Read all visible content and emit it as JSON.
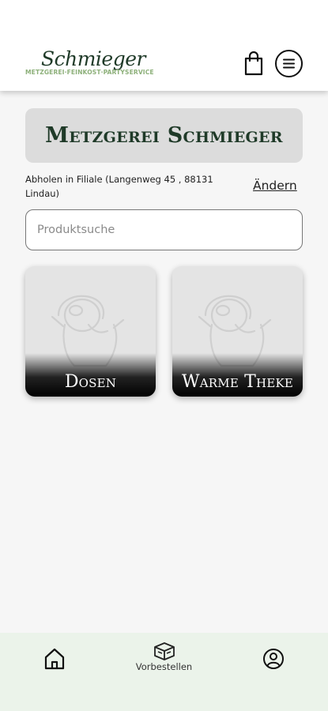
{
  "header": {
    "logo": {
      "script_text": "Schmieger",
      "tagline": "METZGEREI·FEINKOST·PARTYSERVICE"
    },
    "cart_icon": "shopping-bag-icon",
    "menu_icon": "hamburger-menu-icon"
  },
  "store": {
    "title": "Metzgerei Schmieger"
  },
  "pickup": {
    "text": "Abholen in Filiale (Langenweg 45 , 88131 Lindau)",
    "change_label": "Ändern"
  },
  "search": {
    "placeholder": "Produktsuche",
    "value": ""
  },
  "categories": [
    {
      "label": "Dosen",
      "image": "product-placeholder-image"
    },
    {
      "label": "Warme Theke",
      "image": "product-placeholder-image"
    }
  ],
  "bottom_nav": {
    "home_icon": "home-icon",
    "preorder_icon": "box-icon",
    "preorder_label": "Vorbestellen",
    "profile_icon": "user-icon"
  },
  "colors": {
    "brand_dark_green": "#1f3a28",
    "brand_light_green": "#8db07a",
    "nav_background": "#ebf3ea",
    "banner_background": "#dcdcdc"
  }
}
